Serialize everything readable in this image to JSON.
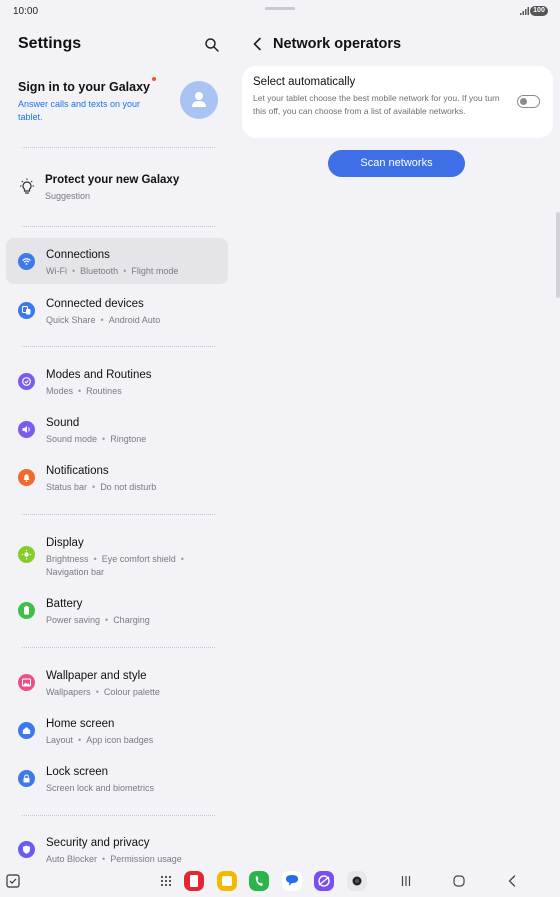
{
  "status_bar": {
    "time": "10:00",
    "battery": "100"
  },
  "left": {
    "title": "Settings",
    "signin": {
      "title": "Sign in to your Galaxy",
      "description": "Answer calls and texts on your tablet."
    },
    "suggestion": {
      "title": "Protect your new Galaxy",
      "subtitle": "Suggestion"
    },
    "items": [
      {
        "title": "Connections",
        "subtitle": [
          "Wi-Fi",
          "Bluetooth",
          "Flight mode"
        ],
        "icon": "wifi-icon",
        "color": "#3d7ae8"
      },
      {
        "title": "Connected devices",
        "subtitle": [
          "Quick Share",
          "Android Auto"
        ],
        "icon": "connected-devices-icon",
        "color": "#3d7ae8"
      },
      {
        "title": "Modes and Routines",
        "subtitle": [
          "Modes",
          "Routines"
        ],
        "icon": "modes-icon",
        "color": "#7a5cf0"
      },
      {
        "title": "Sound",
        "subtitle": [
          "Sound mode",
          "Ringtone"
        ],
        "icon": "sound-icon",
        "color": "#7a5cf0"
      },
      {
        "title": "Notifications",
        "subtitle": [
          "Status bar",
          "Do not disturb"
        ],
        "icon": "notifications-icon",
        "color": "#ef6a2c"
      },
      {
        "title": "Display",
        "subtitle_line1": [
          "Brightness",
          "Eye comfort shield"
        ],
        "subtitle_line2": "Navigation bar",
        "icon": "display-icon",
        "color": "#86cc2a"
      },
      {
        "title": "Battery",
        "subtitle": [
          "Power saving",
          "Charging"
        ],
        "icon": "battery-icon",
        "color": "#3fbf47"
      },
      {
        "title": "Wallpaper and style",
        "subtitle": [
          "Wallpapers",
          "Colour palette"
        ],
        "icon": "wallpaper-icon",
        "color": "#ec4e86"
      },
      {
        "title": "Home screen",
        "subtitle": [
          "Layout",
          "App icon badges"
        ],
        "icon": "home-screen-icon",
        "color": "#3d7ae8"
      },
      {
        "title": "Lock screen",
        "subtitle": [
          "Screen lock and biometrics"
        ],
        "icon": "lock-icon",
        "color": "#3d7ae8"
      },
      {
        "title": "Security and privacy",
        "subtitle": [
          "Auto Blocker",
          "Permission usage"
        ],
        "icon": "security-icon",
        "color": "#6a5cf0"
      }
    ]
  },
  "right": {
    "title": "Network operators",
    "select_auto": {
      "title": "Select automatically",
      "description": "Let your tablet choose the best mobile network for you. If you turn this off, you can choose from a list of available networks.",
      "enabled": false
    },
    "scan_button": "Scan networks"
  },
  "nav_bar": {
    "apps": [
      "apps-grid-icon",
      "red-app-icon",
      "notes-app-icon",
      "phone-app-icon",
      "messages-app-icon",
      "internet-app-icon",
      "camera-app-icon"
    ],
    "buttons": [
      "recents-button",
      "home-button",
      "back-button"
    ]
  }
}
